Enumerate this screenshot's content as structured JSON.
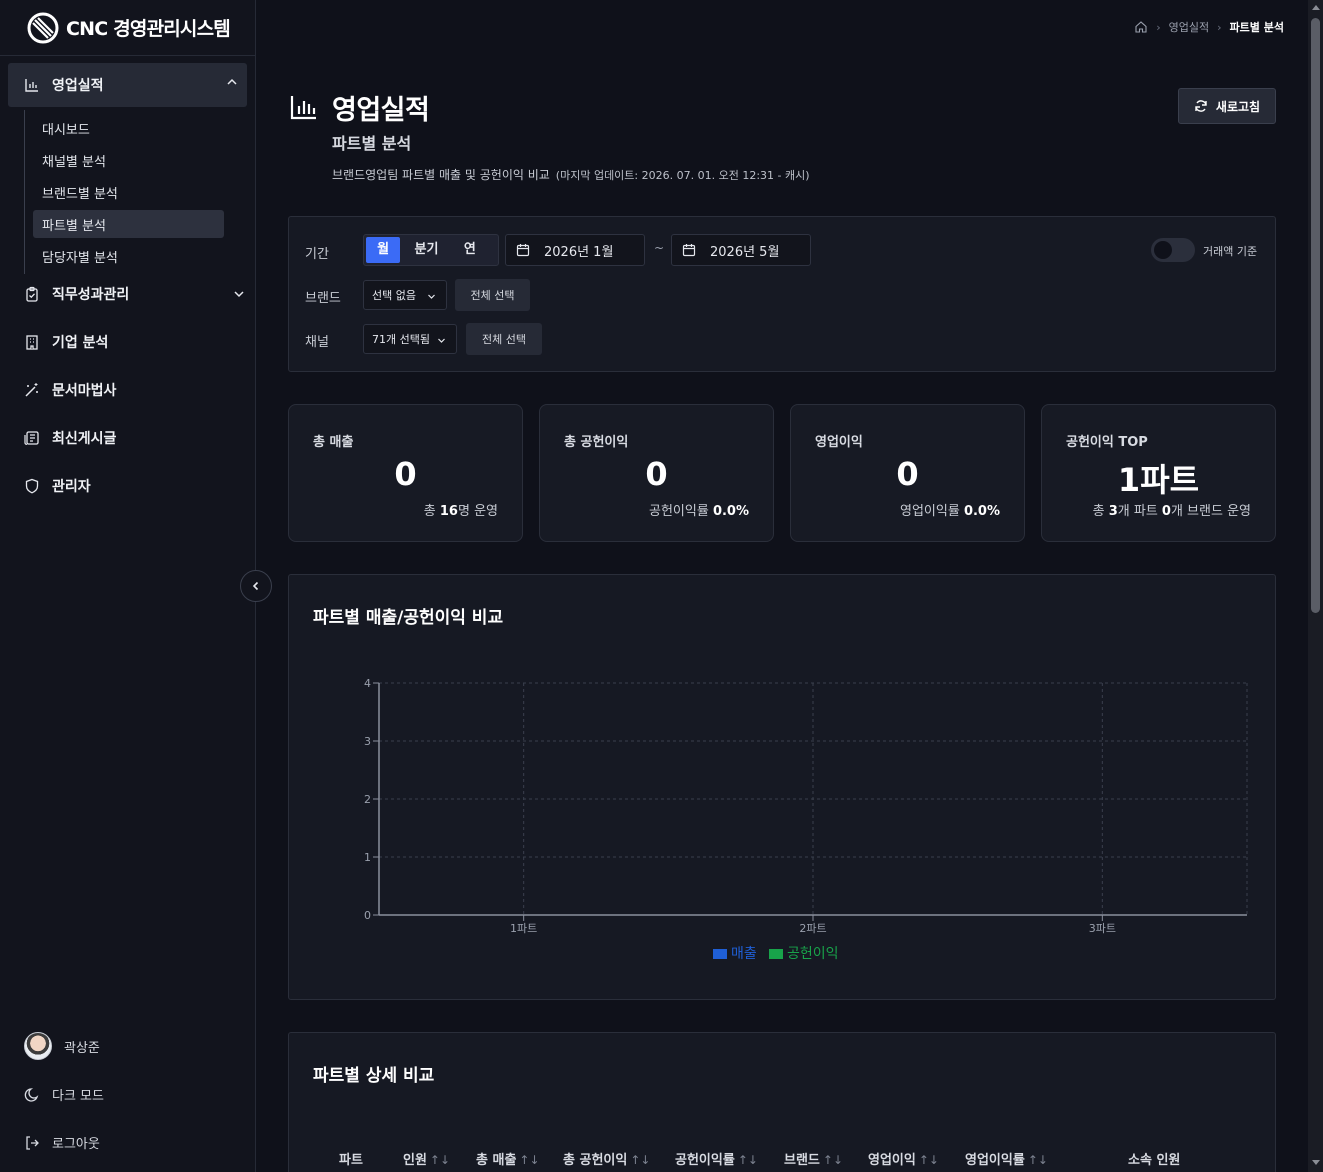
{
  "app": {
    "logo_text": "CNC 경영관리시스템"
  },
  "sidebar": {
    "group": {
      "label": "영업실적",
      "icon": "bar-chart-icon",
      "expanded": true
    },
    "subitems": [
      {
        "label": "대시보드",
        "active": false
      },
      {
        "label": "채널별 분석",
        "active": false
      },
      {
        "label": "브랜드별 분석",
        "active": false
      },
      {
        "label": "파트별 분석",
        "active": true
      },
      {
        "label": "담당자별 분석",
        "active": false
      }
    ],
    "items": [
      {
        "label": "직무성과관리",
        "icon": "clipboard-check-icon",
        "has_children": true
      },
      {
        "label": "기업 분석",
        "icon": "building-icon"
      },
      {
        "label": "문서마법사",
        "icon": "magic-wand-icon"
      },
      {
        "label": "최신게시글",
        "icon": "newspaper-icon"
      },
      {
        "label": "관리자",
        "icon": "shield-icon"
      }
    ],
    "user": {
      "name": "곽상준"
    },
    "dark_mode_label": "다크 모드",
    "logout_label": "로그아웃"
  },
  "breadcrumb": {
    "items": [
      "영업실적",
      "파트별 분석"
    ]
  },
  "header": {
    "title": "영업실적",
    "subtitle": "파트별 분석",
    "description": "브랜드영업팀 파트별 매출 및 공헌이익 비교",
    "update_note": "(마지막 업데이트: 2026. 07. 01. 오전 12:31 - 캐시)",
    "refresh_label": "새로고침"
  },
  "filters": {
    "period_label": "기간",
    "period_options": [
      "월",
      "분기",
      "연"
    ],
    "period_selected": "월",
    "start_date": "2026년 1월",
    "end_date": "2026년 5월",
    "range_sep": "~",
    "toggle_label": "거래액 기준",
    "toggle_on": false,
    "brand_label": "브랜드",
    "brand_value": "선택 없음",
    "channel_label": "채널",
    "channel_value": "71개 선택됨",
    "select_all_label": "전체 선택"
  },
  "kpis": [
    {
      "label": "총 매출",
      "value": "0",
      "foot_pre": "총 ",
      "foot_bold": "16",
      "foot_post": "명 운영"
    },
    {
      "label": "총 공헌이익",
      "value": "0",
      "foot_pre": "공헌이익률 ",
      "foot_bold": "0.0%",
      "foot_post": ""
    },
    {
      "label": "영업이익",
      "value": "0",
      "foot_pre": "영업이익률 ",
      "foot_bold": "0.0%",
      "foot_post": ""
    },
    {
      "label": "공헌이익 TOP",
      "value": "1파트",
      "foot_pre": "총 ",
      "foot_bold": "3",
      "foot_mid": "개 파트 ",
      "foot_bold2": "0",
      "foot_post": "개 브랜드 운영"
    }
  ],
  "chart_title": "파트별 매출/공헌이익 비교",
  "chart_data": {
    "type": "bar",
    "title": "파트별 매출/공헌이익 비교",
    "categories": [
      "1파트",
      "2파트",
      "3파트"
    ],
    "series": [
      {
        "name": "매출",
        "values": [
          0,
          0,
          0
        ],
        "color": "#1f5fd6"
      },
      {
        "name": "공헌이익",
        "values": [
          0,
          0,
          0
        ],
        "color": "#18a34a"
      }
    ],
    "yticks": [
      0,
      1,
      2,
      3,
      4
    ],
    "ylim": [
      0,
      4
    ],
    "grid": true,
    "legend": "bottom-center"
  },
  "table": {
    "title": "파트별 상세 비교",
    "columns": [
      {
        "label": "파트",
        "sortable": false
      },
      {
        "label": "인원",
        "sortable": true
      },
      {
        "label": "총 매출",
        "sortable": true
      },
      {
        "label": "총 공헌이익",
        "sortable": true
      },
      {
        "label": "공헌이익률",
        "sortable": true
      },
      {
        "label": "브랜드",
        "sortable": true
      },
      {
        "label": "영업이익",
        "sortable": true
      },
      {
        "label": "영업이익률",
        "sortable": true
      },
      {
        "label": "소속 인원",
        "sortable": false
      }
    ],
    "sort_glyph": "↑↓"
  }
}
